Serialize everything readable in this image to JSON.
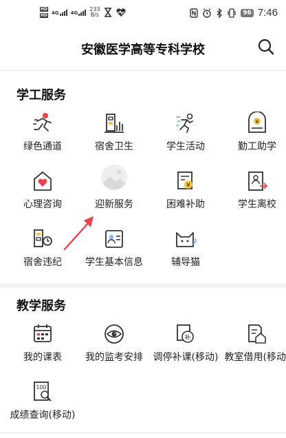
{
  "status_bar": {
    "hd1": "HD",
    "hd2": "HD",
    "net1": "4G",
    "net2": "4G",
    "speed_value": "233",
    "speed_unit": "B/s",
    "battery": "96",
    "time": "7:46"
  },
  "header": {
    "title": "安徽医学高等专科学校"
  },
  "sections": {
    "student_work": {
      "title": "学工服务",
      "items": [
        {
          "label": "绿色通道",
          "icon": "runner-icon"
        },
        {
          "label": "宿舍卫生",
          "icon": "dorm-chart-icon"
        },
        {
          "label": "学生活动",
          "icon": "activity-icon"
        },
        {
          "label": "勤工助学",
          "icon": "work-study-icon"
        },
        {
          "label": "心理咨询",
          "icon": "heart-house-icon"
        },
        {
          "label": "迎新服务",
          "icon": "image-placeholder-icon"
        },
        {
          "label": "困难补助",
          "icon": "subsidy-icon"
        },
        {
          "label": "学生离校",
          "icon": "leave-school-icon"
        },
        {
          "label": "宿舍违纪",
          "icon": "dorm-violation-icon"
        },
        {
          "label": "学生基本信息",
          "icon": "id-card-icon"
        },
        {
          "label": "辅导猫",
          "icon": "cat-icon"
        }
      ]
    },
    "teaching": {
      "title": "教学服务",
      "items": [
        {
          "label": "我的课表",
          "icon": "calendar-icon"
        },
        {
          "label": "我的监考安排",
          "icon": "eye-icon"
        },
        {
          "label": "调停补课(移动)",
          "icon": "makeup-class-icon"
        },
        {
          "label": "教室借用(移动)",
          "icon": "classroom-borrow-icon"
        },
        {
          "label": "成绩查询(移动)",
          "icon": "grade-search-icon"
        }
      ]
    }
  },
  "colors": {
    "accent_red": "#e8434a",
    "icon_stroke": "#333333",
    "highlight_yellow": "#f5c443",
    "highlight_blue": "#7fb3f5",
    "highlight_pink": "#f4a6b0"
  },
  "grade_icon_text": "100",
  "subsidy_icon_text": "¥",
  "makeup_icon_text": "补"
}
